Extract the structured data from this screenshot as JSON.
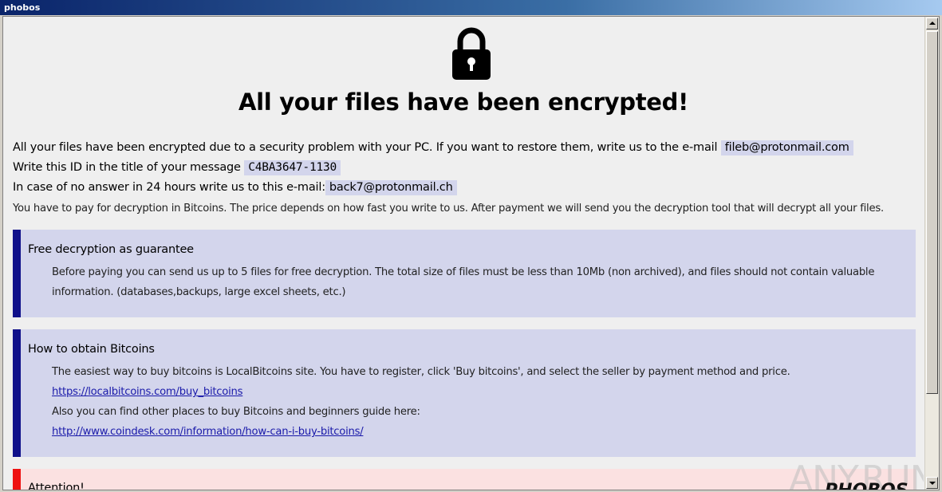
{
  "window": {
    "title": "phobos"
  },
  "note": {
    "headline": "All your files have been encrypted!",
    "line1_text": "All your files have been encrypted due to a security problem with your PC. If you want to restore them, write us to the e-mail",
    "line1_email": "fileb@protonmail.com",
    "line2_text": "Write this ID in the title of your message",
    "line2_id": "C4BA3647-1130",
    "line3_text": "In case of no answer in 24 hours write us to this e-mail:",
    "line3_email": "back7@protonmail.ch",
    "line4_text": "You have to pay for decryption in Bitcoins. The price depends on how fast you write to us. After payment we will send you the decryption tool that will decrypt all your files."
  },
  "sections": {
    "free": {
      "title": "Free decryption as guarantee",
      "body": "Before paying you can send us up to 5 files for free decryption. The total size of files must be less than 10Mb (non archived), and files should not contain valuable information. (databases,backups, large excel sheets, etc.)"
    },
    "bitcoins": {
      "title": "How to obtain Bitcoins",
      "text1": "The easiest way to buy bitcoins is LocalBitcoins site. You have to register, click 'Buy bitcoins', and select the seller by payment method and price.",
      "link1": "https://localbitcoins.com/buy_bitcoins",
      "text2": "Also you can find other places to buy Bitcoins and beginners guide here:",
      "link2": "http://www.coindesk.com/information/how-can-i-buy-bitcoins/"
    },
    "attention": {
      "title": "Attention!"
    }
  },
  "branding": {
    "logo": "PHOBOS",
    "watermark": "ANY.RUN"
  },
  "icons": {
    "lock": "padlock-icon"
  }
}
